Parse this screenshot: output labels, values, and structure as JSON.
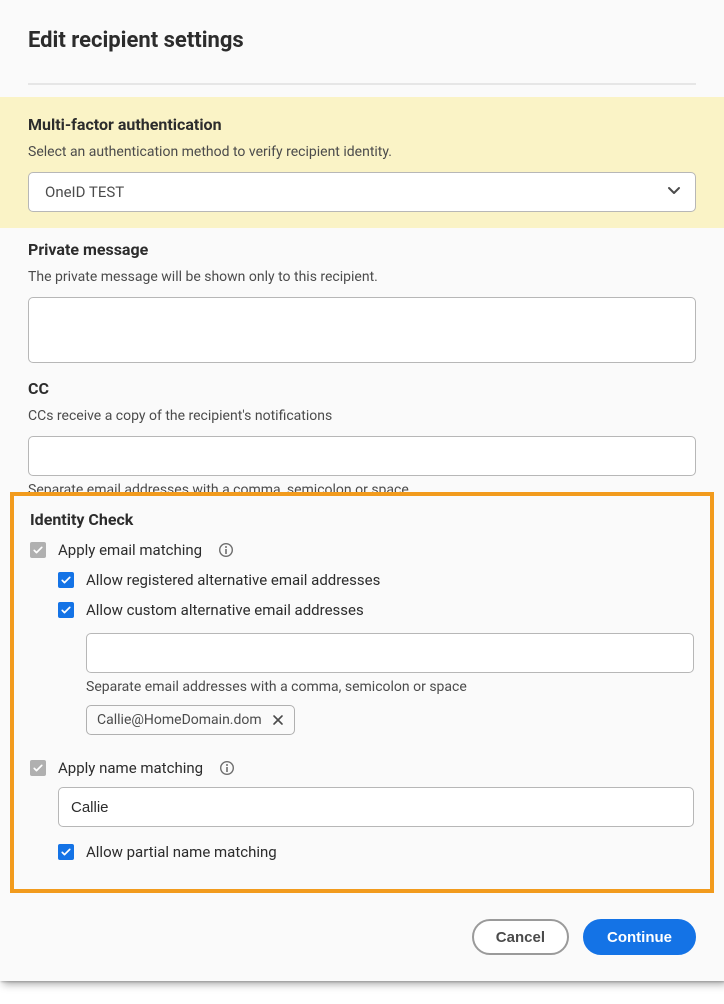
{
  "header": {
    "title": "Edit recipient settings"
  },
  "mfa": {
    "title": "Multi-factor authentication",
    "desc": "Select an authentication method to verify recipient identity.",
    "selected": "OneID TEST"
  },
  "privateMessage": {
    "title": "Private message",
    "desc": "The private message will be shown only to this recipient.",
    "value": ""
  },
  "cc": {
    "title": "CC",
    "desc": "CCs receive a copy of the recipient's notifications",
    "value": "",
    "hint": "Separate email addresses with a comma, semicolon or space"
  },
  "identity": {
    "title": "Identity Check",
    "emailMatching": {
      "label": "Apply email matching",
      "checked": true
    },
    "allowRegistered": {
      "label": "Allow registered alternative email addresses",
      "checked": true
    },
    "allowCustom": {
      "label": "Allow custom alternative email addresses",
      "checked": true,
      "inputValue": "",
      "hint": "Separate email addresses with a comma, semicolon or space",
      "chips": [
        "Callie@HomeDomain.dom"
      ]
    },
    "nameMatching": {
      "label": "Apply name matching",
      "checked": true,
      "value": "Callie"
    },
    "allowPartial": {
      "label": "Allow partial name matching",
      "checked": true
    }
  },
  "footer": {
    "cancel": "Cancel",
    "continue": "Continue"
  }
}
